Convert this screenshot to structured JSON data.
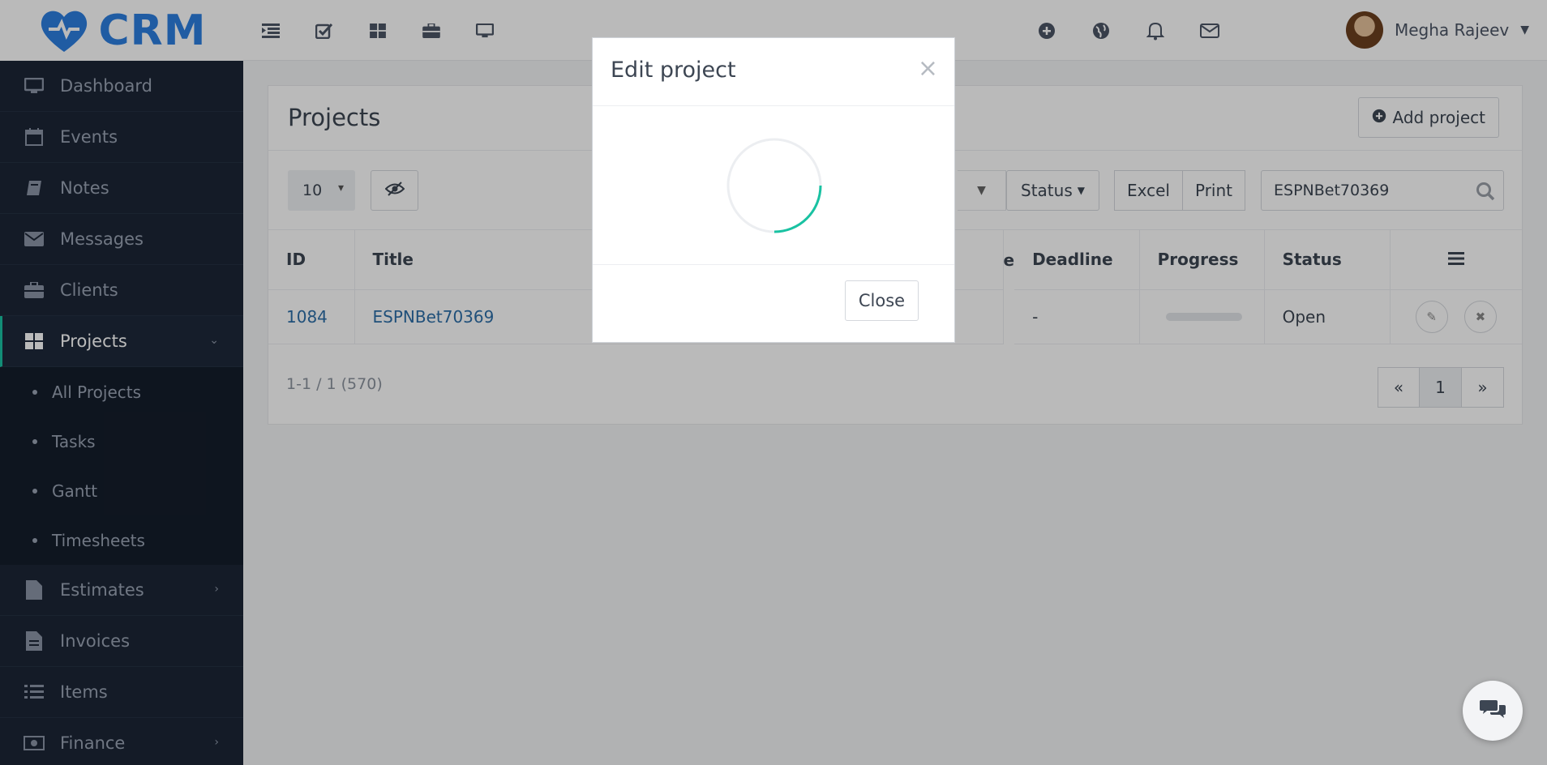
{
  "brand": {
    "name": "CRM",
    "icon": "heart-logo",
    "color": "#2d7fe0"
  },
  "sidebar": {
    "items": [
      {
        "label": "Dashboard",
        "icon": "monitor-icon"
      },
      {
        "label": "Events",
        "icon": "calendar-icon"
      },
      {
        "label": "Notes",
        "icon": "book-icon"
      },
      {
        "label": "Messages",
        "icon": "envelope-icon"
      },
      {
        "label": "Clients",
        "icon": "briefcase-icon"
      },
      {
        "label": "Projects",
        "icon": "grid-icon",
        "active": true,
        "expanded": true
      },
      {
        "label": "Estimates",
        "icon": "file-icon",
        "has_children": true
      },
      {
        "label": "Invoices",
        "icon": "file-text-icon"
      },
      {
        "label": "Items",
        "icon": "list-icon"
      },
      {
        "label": "Finance",
        "icon": "money-icon",
        "has_children": true
      }
    ],
    "sub_items": [
      "All Projects",
      "Tasks",
      "Gantt",
      "Timesheets"
    ]
  },
  "topbar": {
    "left_icons": [
      "menu-toggle-icon",
      "check-square-icon",
      "grid-icon",
      "briefcase-icon",
      "monitor-icon"
    ],
    "right_icons": [
      "plus-circle-icon",
      "globe-icon",
      "bell-icon",
      "envelope-icon"
    ],
    "user_name": "Megha Rajeev"
  },
  "projects": {
    "title": "Projects",
    "add_button": "Add project",
    "page_size": "10",
    "status_filter": "Status",
    "export_buttons": [
      "Excel",
      "Print"
    ],
    "search_value": "ESPNBet70369",
    "columns": [
      "ID",
      "Title",
      "e",
      "Deadline",
      "Progress",
      "Status"
    ],
    "rows": [
      {
        "id": "1084",
        "title": "ESPNBet70369",
        "deadline": "-",
        "progress": 0,
        "status": "Open"
      }
    ],
    "count_text": "1-1 / 1 (570)",
    "pagination": {
      "prev": "«",
      "current": "1",
      "next": "»"
    }
  },
  "modal": {
    "title": "Edit project",
    "close_x": "×",
    "close_button": "Close",
    "loading": true
  },
  "colors": {
    "accent": "#19c2a2",
    "sidebar_bg": "#1c2636",
    "link": "#2d6ea8"
  }
}
